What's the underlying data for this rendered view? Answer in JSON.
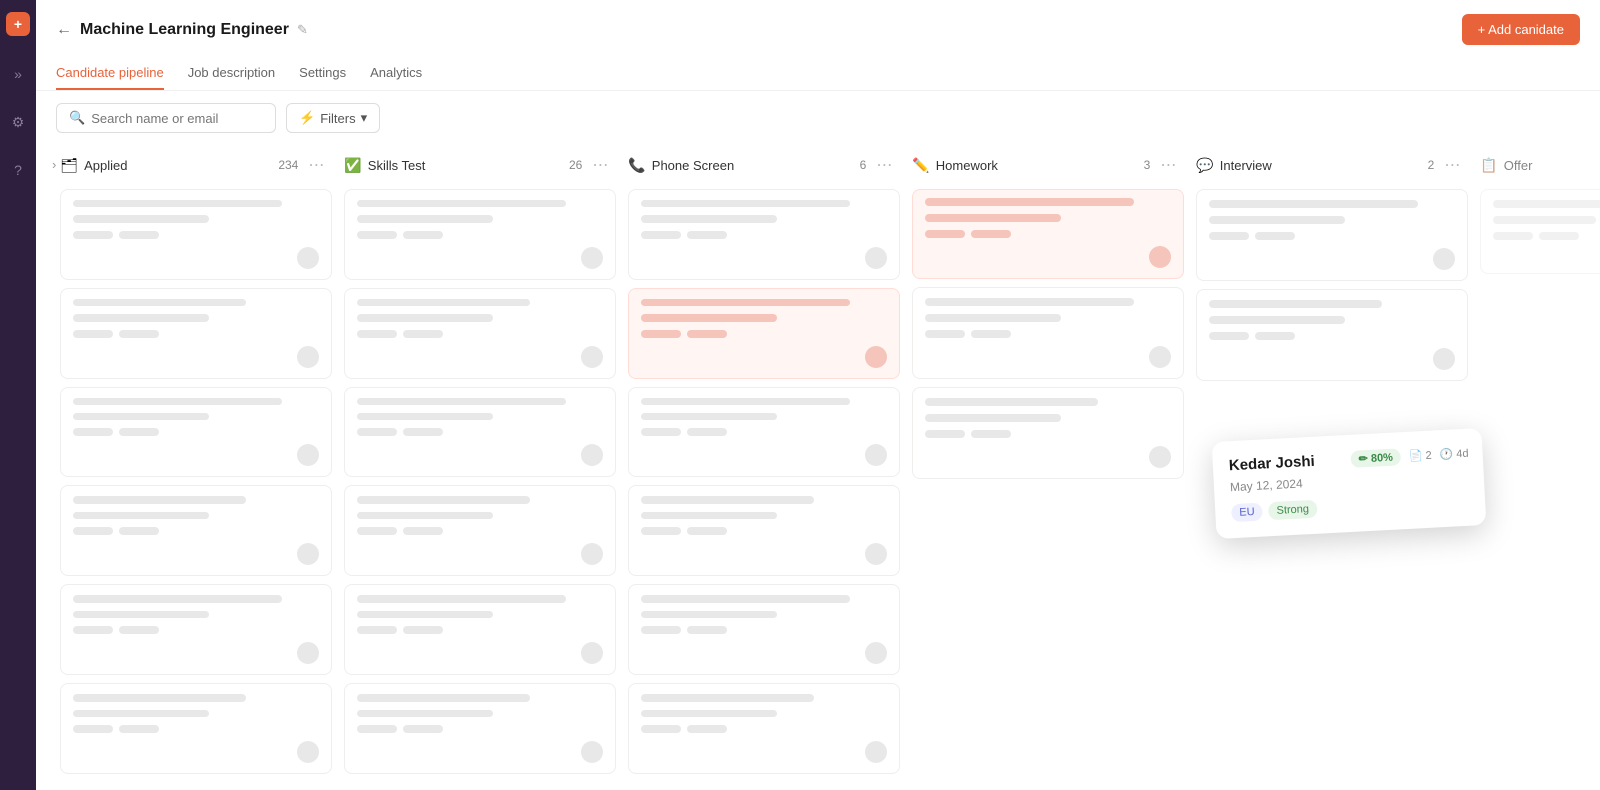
{
  "sidebar": {
    "logo": "+",
    "icons": [
      "»",
      "⚙",
      "?"
    ]
  },
  "header": {
    "title": "Machine Learning Engineer",
    "back_label": "←",
    "edit_label": "✎",
    "add_button": "+ Add canidate"
  },
  "tabs": [
    {
      "id": "pipeline",
      "label": "Candidate pipeline",
      "active": true
    },
    {
      "id": "description",
      "label": "Job description",
      "active": false
    },
    {
      "id": "settings",
      "label": "Settings",
      "active": false
    },
    {
      "id": "analytics",
      "label": "Analytics",
      "active": false
    }
  ],
  "toolbar": {
    "search_placeholder": "Search name or email",
    "filter_label": "Filters"
  },
  "columns": [
    {
      "id": "applied",
      "title": "Applied",
      "count": "234",
      "icon": "🗂",
      "color": "#4a9be8"
    },
    {
      "id": "skills",
      "title": "Skills Test",
      "count": "26",
      "icon": "✅",
      "color": "#3aaa5a"
    },
    {
      "id": "phone",
      "title": "Phone Screen",
      "count": "6",
      "icon": "📞",
      "color": "#e86a3a"
    },
    {
      "id": "homework",
      "title": "Homework",
      "count": "3",
      "icon": "✏️",
      "color": "#e8a83a"
    },
    {
      "id": "interview",
      "title": "Interview",
      "count": "2",
      "icon": "💬",
      "color": "#8a6ae8"
    },
    {
      "id": "offer",
      "title": "Offer",
      "count": "",
      "icon": "📋",
      "color": "#888"
    }
  ],
  "floating_card": {
    "name": "Kedar Joshi",
    "date": "May 12, 2024",
    "score": "80%",
    "score_icon": "✏",
    "tags": [
      "EU",
      "Strong"
    ],
    "doc_count": "2",
    "time_ago": "4d"
  }
}
